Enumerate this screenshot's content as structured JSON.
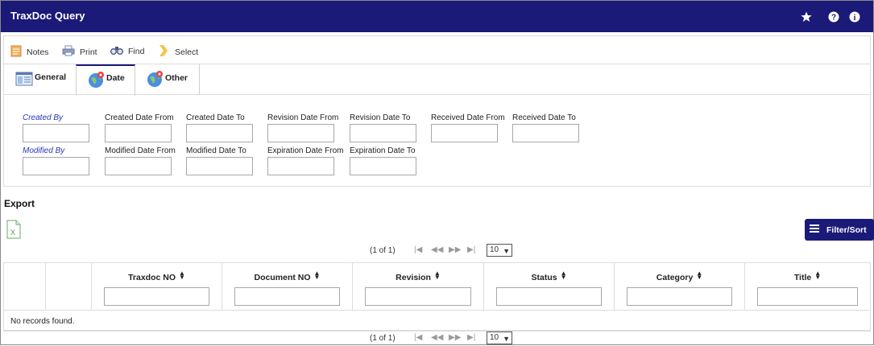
{
  "app": {
    "title": "TraxDoc Query"
  },
  "header_icons": [
    "star-icon",
    "help-icon",
    "info-icon"
  ],
  "toolbar": {
    "notes_label": "Notes",
    "print_label": "Print",
    "find_label": "Find",
    "select_label": "Select"
  },
  "tabs": [
    {
      "label": "General",
      "icon": "general-icon",
      "active": false
    },
    {
      "label": "Date",
      "icon": "globe-icon",
      "active": true
    },
    {
      "label": "Other",
      "icon": "globe-icon",
      "active": false
    }
  ],
  "criteria": {
    "created_by": {
      "label": "Created By",
      "value": ""
    },
    "modified_by": {
      "label": "Modified By",
      "value": ""
    },
    "created_date_from": {
      "label": "Created Date From",
      "value": ""
    },
    "created_date_to": {
      "label": "Created Date To",
      "value": ""
    },
    "revision_date_from": {
      "label": "Revision Date From",
      "value": ""
    },
    "revision_date_to": {
      "label": "Revision Date To",
      "value": ""
    },
    "received_date_from": {
      "label": "Received Date From",
      "value": ""
    },
    "received_date_to": {
      "label": "Received Date To",
      "value": ""
    },
    "modified_date_from": {
      "label": "Modified Date From",
      "value": ""
    },
    "modified_date_to": {
      "label": "Modified Date To",
      "value": ""
    },
    "expiration_date_from": {
      "label": "Expiration Date From",
      "value": ""
    },
    "expiration_date_to": {
      "label": "Expiration Date To",
      "value": ""
    }
  },
  "export": {
    "label": "Export",
    "icon": "excel-icon"
  },
  "filter_sort": {
    "label": "Filter/Sort"
  },
  "pager": {
    "count_text": "(1 of 1)",
    "page_size": "10",
    "colors": {
      "disabled": "#9a9a9a"
    }
  },
  "grid": {
    "columns": [
      {
        "label": "Traxdoc NO",
        "filter": ""
      },
      {
        "label": "Document NO",
        "filter": ""
      },
      {
        "label": "Revision",
        "filter": ""
      },
      {
        "label": "Status",
        "filter": ""
      },
      {
        "label": "Category",
        "filter": ""
      },
      {
        "label": "Title",
        "filter": ""
      }
    ],
    "empty_message": "No records found."
  },
  "colors": {
    "brand": "#1b1a78",
    "link": "#2a33b8",
    "border": "#dcdcdc"
  }
}
